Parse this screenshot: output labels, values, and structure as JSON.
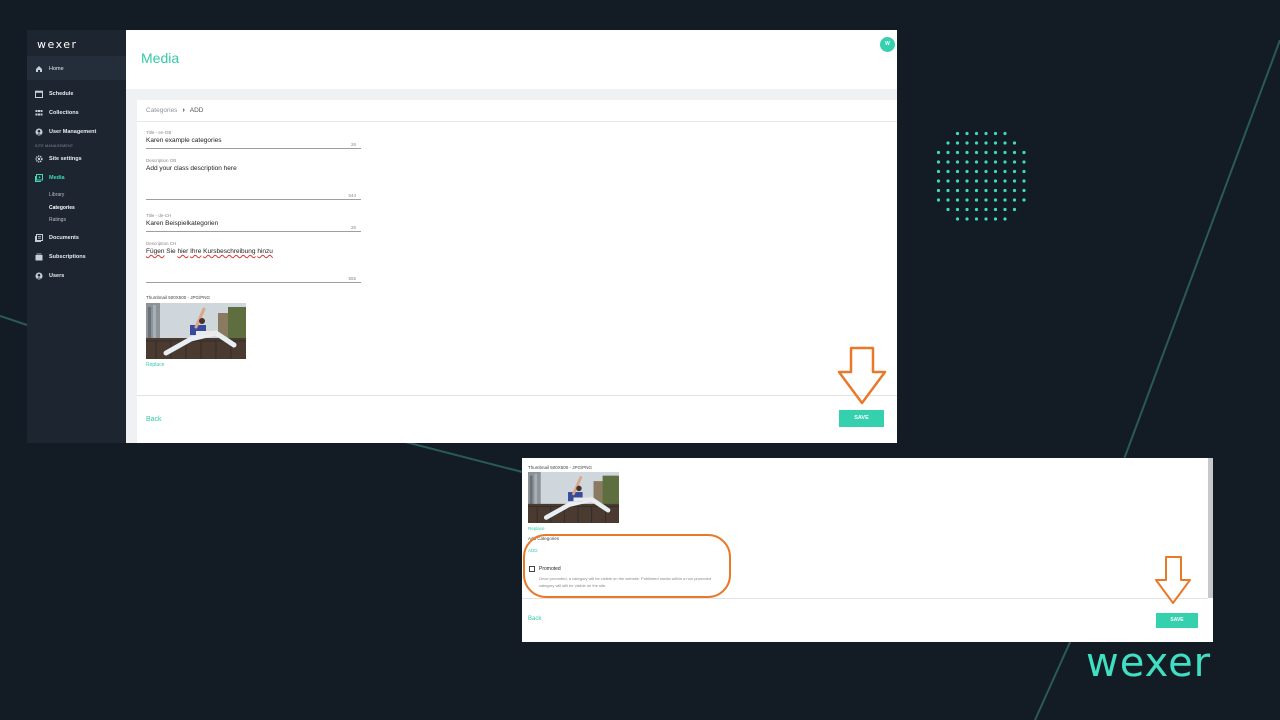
{
  "app": {
    "logo": "wexer",
    "avatar_initial": "W"
  },
  "sidebar": {
    "home": "Home",
    "items": [
      {
        "label": "Schedule",
        "icon": "calendar-icon"
      },
      {
        "label": "Collections",
        "icon": "grid-icon"
      },
      {
        "label": "User Management",
        "icon": "user-circle-icon"
      }
    ],
    "section_label": "SITE MANAGEMENT",
    "site_settings": "Site settings",
    "media": "Media",
    "media_sub": [
      "Library",
      "Categories",
      "Ratings"
    ],
    "lower_items": [
      {
        "label": "Documents",
        "icon": "document-icon"
      },
      {
        "label": "Subscriptions",
        "icon": "subscriptions-icon"
      },
      {
        "label": "Users",
        "icon": "users-icon"
      }
    ]
  },
  "header": {
    "title": "Media"
  },
  "breadcrumb": {
    "parent": "Categories",
    "separator": "›",
    "current": "ADD"
  },
  "form": {
    "title_gb": {
      "label": "Title - en-GB",
      "value": "Karen example categories",
      "count": "26"
    },
    "desc_gb": {
      "label": "Description GB",
      "value": "Add your class description here",
      "count": "544"
    },
    "title_ch": {
      "label": "Title - de-CH",
      "value": "Karen Beispielkategorien",
      "count": "26"
    },
    "desc_ch": {
      "label": "Description CH",
      "value_parts": [
        "Fügen",
        " Sie ",
        "hier",
        " ",
        "Ihre",
        " ",
        "Kursbeschreibung",
        " ",
        "hinzu"
      ],
      "count": "555"
    },
    "thumbnail_label": "Thumbnail 500X500 - JPG/PNG",
    "replace_label": "Replace"
  },
  "footer": {
    "back_label": "Back",
    "save_label": "SAVE"
  },
  "second": {
    "thumbnail_label": "Thumbnail 500X500 - JPG/PNG",
    "replace_label": "Replace",
    "add_categories_label": "Add Categories",
    "add_label": "ADD",
    "promoted_label": "Promoted",
    "promoted_help": "Once promoted, a category will be visible on the website. Published media within a non promoted category will still be visible on the site.",
    "back_label": "Back",
    "save_label": "SAVE"
  },
  "brand": {
    "logo": "wexer"
  },
  "colors": {
    "accent": "#35d0ad",
    "sidebar_bg": "#1c2530",
    "page_bg": "#131c24",
    "highlight": "#e8792b"
  }
}
